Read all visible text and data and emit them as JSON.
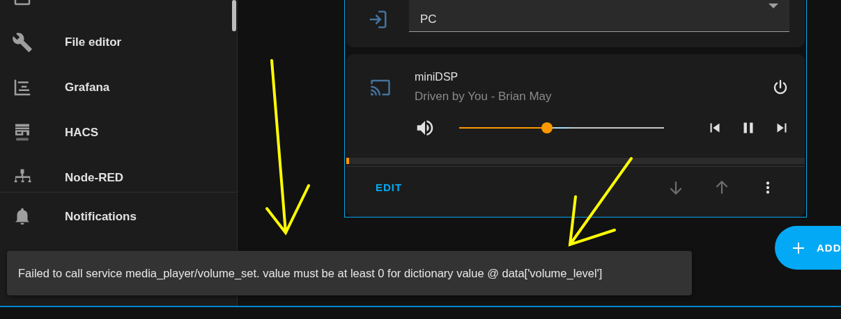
{
  "sidebar": {
    "items": [
      {
        "kind": "calendar"
      },
      {
        "label": "File editor",
        "kind": "wrench"
      },
      {
        "label": "Grafana",
        "kind": "chart"
      },
      {
        "label": "HACS",
        "kind": "hacs"
      },
      {
        "label": "Node-RED",
        "kind": "network"
      }
    ],
    "notifications": {
      "label": "Notifications"
    }
  },
  "input_card": {
    "value": "PC"
  },
  "media_card": {
    "name": "miniDSP",
    "track": "Driven by You - Brian May",
    "volume": {
      "level": 0.43
    },
    "progress": {
      "level": 0.006
    }
  },
  "edit_bar": {
    "edit": "EDIT"
  },
  "add_button": {
    "label": "ADD"
  },
  "toast": {
    "message": "Failed to call service media_player/volume_set. value must be at least 0 for dictionary value @ data['volume_level']"
  }
}
